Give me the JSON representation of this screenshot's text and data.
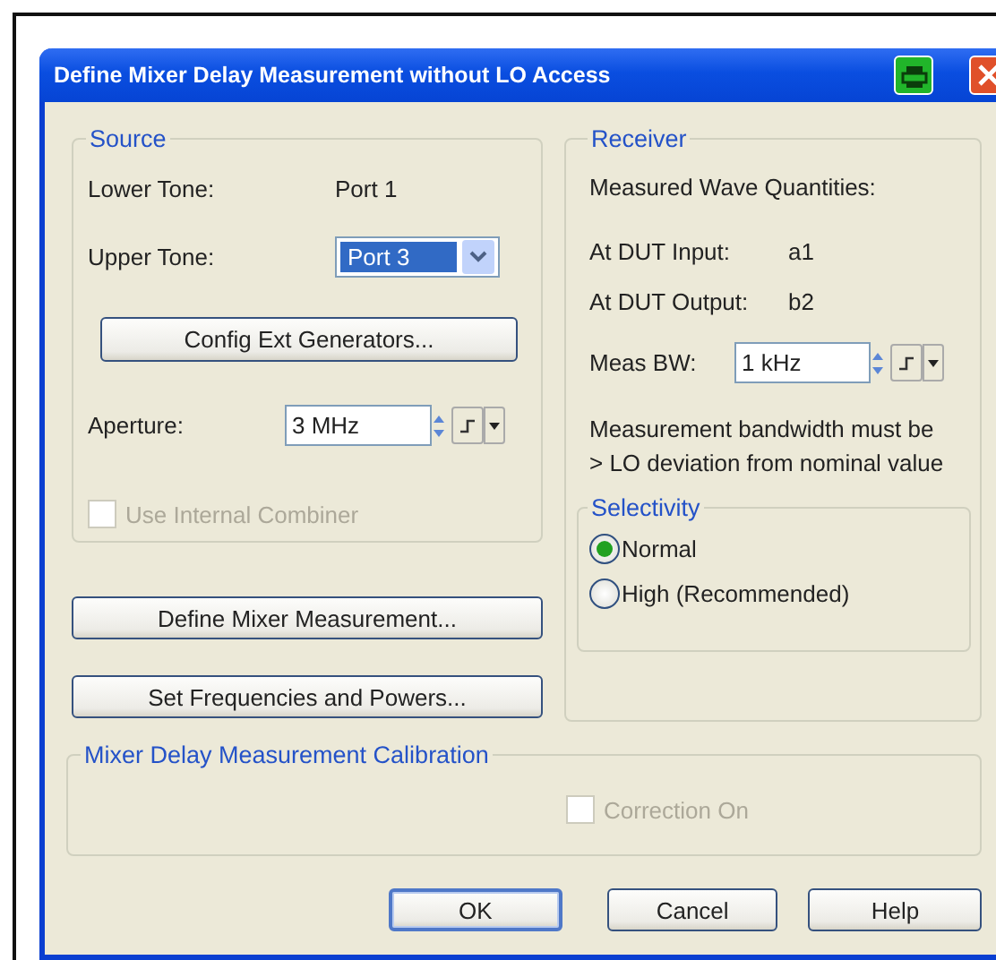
{
  "window": {
    "title": "Define Mixer Delay Measurement without LO Access"
  },
  "source": {
    "title": "Source",
    "lower_tone": {
      "label": "Lower Tone:",
      "value": "Port 1"
    },
    "upper_tone": {
      "label": "Upper Tone:",
      "value": "Port 3"
    },
    "config_button": "Config Ext Generators...",
    "aperture": {
      "label": "Aperture:",
      "value": "3 MHz"
    },
    "combiner": {
      "label": "Use Internal Combiner",
      "checked": false,
      "disabled": true
    }
  },
  "receiver": {
    "title": "Receiver",
    "heading": "Measured Wave Quantities:",
    "waves": [
      {
        "label": "At DUT Input:",
        "value": "a1"
      },
      {
        "label": "At DUT Output:",
        "value": "b2"
      }
    ],
    "meas_bw": {
      "label": "Meas BW:",
      "value": "1 kHz"
    },
    "note": "Measurement bandwidth must be > LO deviation from nominal value",
    "selectivity": {
      "title": "Selectivity",
      "options": [
        {
          "label": "Normal",
          "selected": true
        },
        {
          "label": "High (Recommended)",
          "selected": false
        }
      ]
    }
  },
  "side_buttons": [
    "Define Mixer Measurement...",
    "Set Frequencies and Powers..."
  ],
  "calibration": {
    "title": "Mixer Delay Measurement Calibration",
    "correction": {
      "label": "Correction On",
      "checked": false,
      "disabled": true
    }
  },
  "buttons": [
    {
      "label": "OK",
      "default": true
    },
    {
      "label": "Cancel",
      "default": false
    },
    {
      "label": "Help",
      "default": false
    }
  ]
}
